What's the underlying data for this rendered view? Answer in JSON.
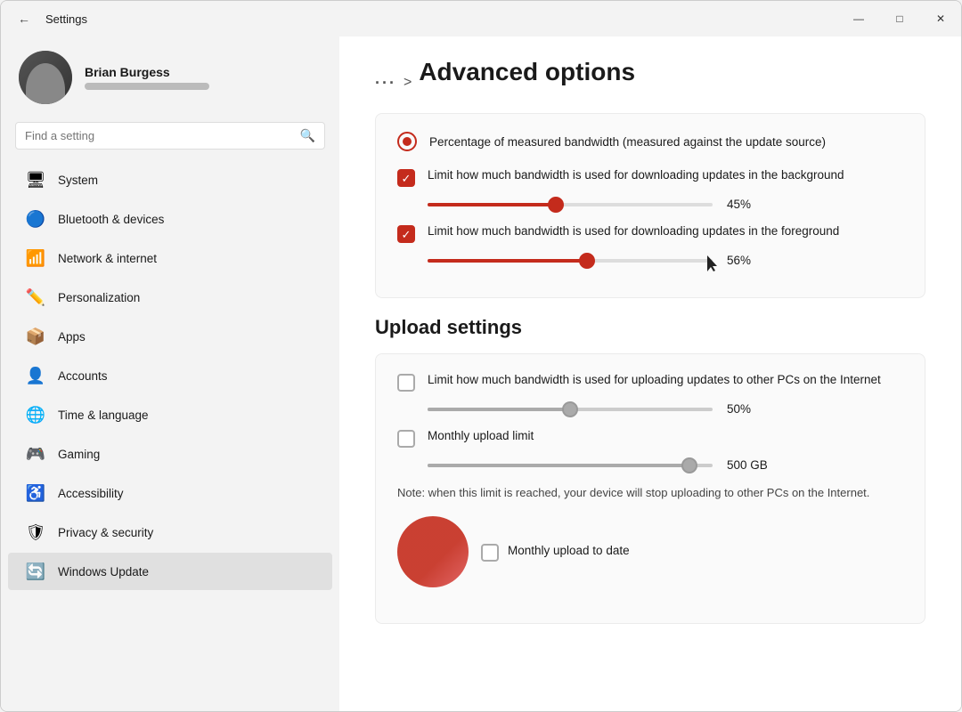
{
  "window": {
    "title": "Settings",
    "back_icon": "←",
    "dots": "···",
    "breadcrumb_sep": ">",
    "page_title": "Advanced options"
  },
  "titlebar": {
    "minimize": "—",
    "maximize": "□",
    "close": "✕"
  },
  "user": {
    "name": "Brian Burgess"
  },
  "search": {
    "placeholder": "Find a setting"
  },
  "nav": [
    {
      "id": "system",
      "label": "System",
      "icon": "🖥"
    },
    {
      "id": "bluetooth",
      "label": "Bluetooth & devices",
      "icon": "🔵"
    },
    {
      "id": "network",
      "label": "Network & internet",
      "icon": "📶"
    },
    {
      "id": "personalization",
      "label": "Personalization",
      "icon": "✏️"
    },
    {
      "id": "apps",
      "label": "Apps",
      "icon": "📦"
    },
    {
      "id": "accounts",
      "label": "Accounts",
      "icon": "👤"
    },
    {
      "id": "time",
      "label": "Time & language",
      "icon": "🌐"
    },
    {
      "id": "gaming",
      "label": "Gaming",
      "icon": "🎮"
    },
    {
      "id": "accessibility",
      "label": "Accessibility",
      "icon": "♿"
    },
    {
      "id": "privacy",
      "label": "Privacy & security",
      "icon": "🛡"
    },
    {
      "id": "windows-update",
      "label": "Windows Update",
      "icon": "🔄"
    }
  ],
  "content": {
    "radio_label": "Percentage of measured bandwidth (measured against the update source)",
    "checkbox1_label": "Limit how much bandwidth is used for downloading updates in the background",
    "slider1_value": "45%",
    "slider1_pct": 45,
    "checkbox2_label": "Limit how much bandwidth is used for downloading updates in the foreground",
    "slider2_value": "56%",
    "slider2_pct": 56,
    "upload_title": "Upload settings",
    "upload_check_label": "Limit how much bandwidth is used for uploading updates to other PCs on the Internet",
    "upload_slider_value": "50%",
    "upload_slider_pct": 50,
    "monthly_limit_label": "Monthly upload limit",
    "monthly_limit_value": "500 GB",
    "monthly_slider_pct": 92,
    "note": "Note: when this limit is reached, your device will stop uploading to other PCs on the Internet.",
    "monthly_upload_date_label": "Monthly upload to date"
  }
}
